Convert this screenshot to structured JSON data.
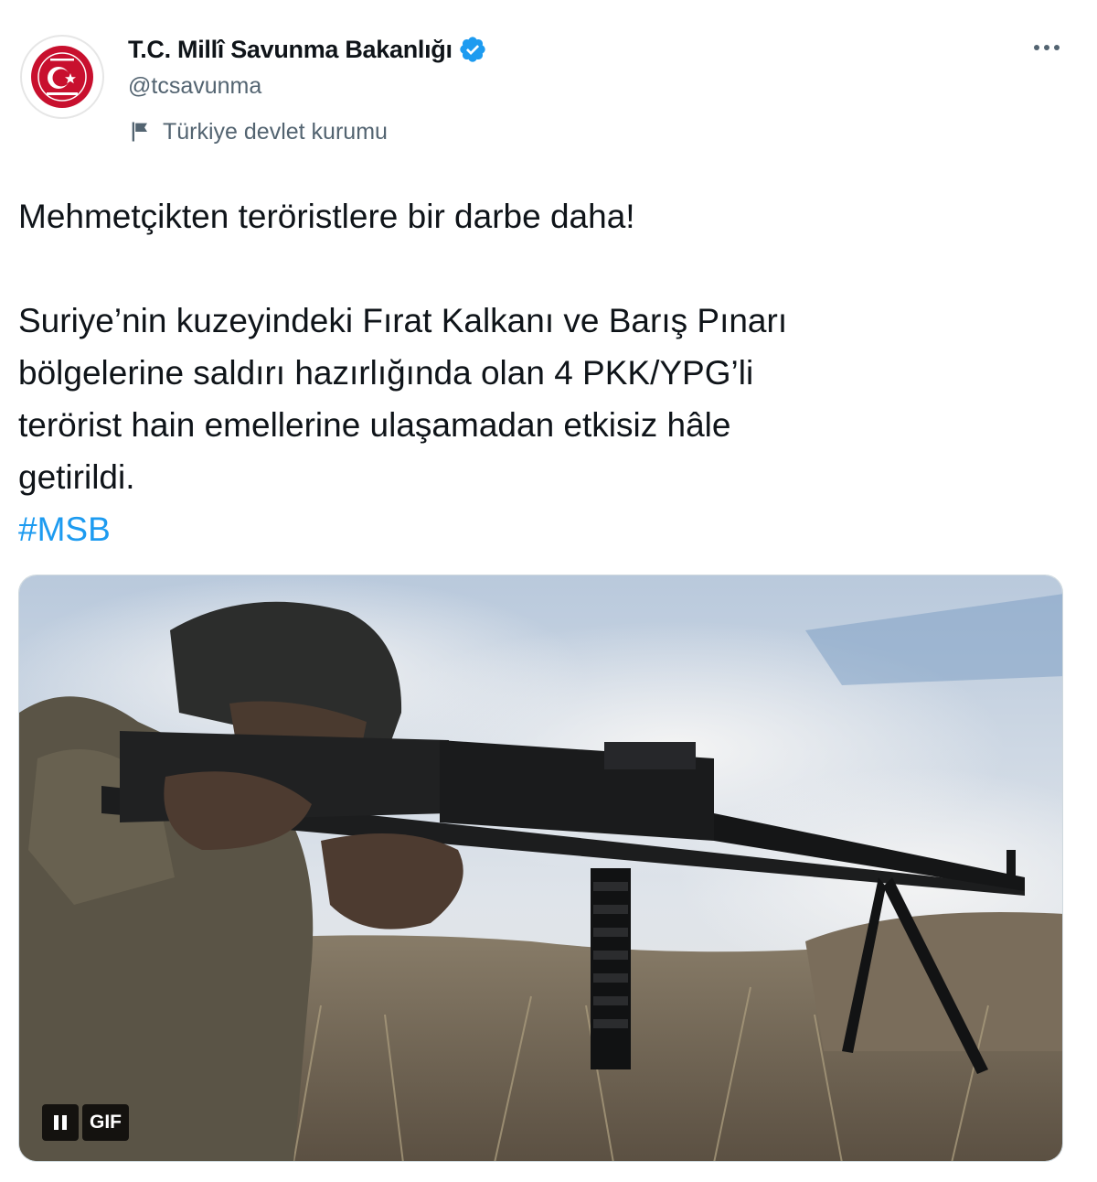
{
  "account": {
    "display_name": "T.C. Millî Savunma Bakanlığı",
    "handle": "@tcsavunma",
    "verified": true,
    "label": "Türkiye devlet kurumu"
  },
  "tweet": {
    "headline": "Mehmetçikten teröristlere bir darbe daha!",
    "body_lines": [
      "Suriye’nin kuzeyindeki Fırat Kalkanı ve Barış Pınarı",
      "bölgelerine saldırı hazırlığında olan 4 PKK/YPG’li",
      "terörist hain emellerine ulaşamadan etkisiz hâle",
      "getirildi."
    ],
    "hashtag": "#MSB"
  },
  "media": {
    "type": "gif",
    "badge": "GIF",
    "pause_icon": "pause-icon"
  },
  "icons": {
    "verified": "verified-badge-icon",
    "label": "flag-icon",
    "more": "more-options-icon"
  },
  "colors": {
    "accent": "#1d9bf0",
    "secondary_text": "#536471",
    "emblem_red": "#c8102e"
  }
}
